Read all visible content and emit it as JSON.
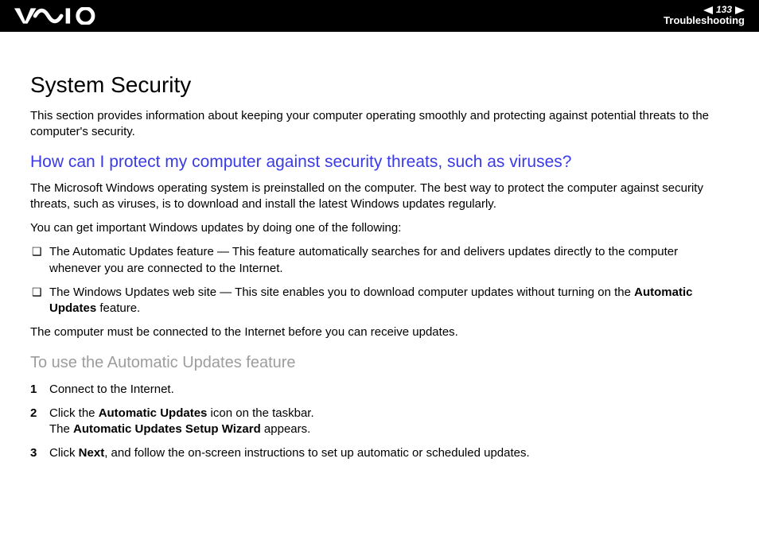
{
  "header": {
    "page_number": "133",
    "section": "Troubleshooting"
  },
  "main": {
    "title": "System Security",
    "intro": "This section provides information about keeping your computer operating smoothly and protecting against potential threats to the computer's security.",
    "question": "How can I protect my computer against security threats, such as viruses?",
    "answer_p1": "The Microsoft Windows operating system is preinstalled on the computer. The best way to protect the computer against security threats, such as viruses, is to download and install the latest Windows updates regularly.",
    "answer_p2": "You can get important Windows updates by doing one of the following:",
    "bullets": [
      {
        "text_before": "The Automatic Updates feature — This feature automatically searches for and delivers updates directly to the computer whenever you are connected to the Internet."
      },
      {
        "text_before": "The Windows Updates web site — This site enables you to download computer updates without turning on the ",
        "bold": "Automatic Updates",
        "text_after": " feature."
      }
    ],
    "note": "The computer must be connected to the Internet before you can receive updates.",
    "subheading": "To use the Automatic Updates feature",
    "steps": [
      {
        "num": "1",
        "line1": "Connect to the Internet."
      },
      {
        "num": "2",
        "line1_a": "Click the ",
        "line1_bold1": "Automatic Updates",
        "line1_b": " icon on the taskbar.",
        "line2_a": "The ",
        "line2_bold1": "Automatic Updates Setup Wizard",
        "line2_b": " appears."
      },
      {
        "num": "3",
        "line1_a": "Click ",
        "line1_bold1": "Next",
        "line1_b": ", and follow the on-screen instructions to set up automatic or scheduled updates."
      }
    ]
  }
}
